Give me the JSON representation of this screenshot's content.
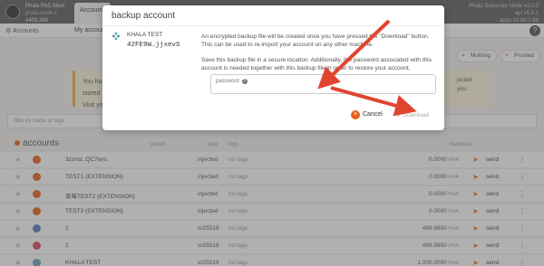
{
  "topbar": {
    "chain_name": "Phala PoC-Next",
    "chain_sub": "phala-node-1",
    "block": "#409,380",
    "tab": "Accounts",
    "node_name": "Phala Substrate Node v3.0.0",
    "api": "api v5.5.1",
    "apps": "apps v0.94.2-86"
  },
  "subbar": {
    "accounts": "Accounts",
    "my": "My account",
    "help": "?"
  },
  "actions": {
    "multisig": "Multisig",
    "proxied": "Proxied"
  },
  "banner": {
    "line1": "You ha",
    "line2": "stored",
    "line3": "Visit yo",
    "side1": "jected",
    "side2": "you."
  },
  "filter": {
    "placeholder": "filter by name or tags"
  },
  "table": {
    "title": "accounts",
    "headers": {
      "parent": "parent",
      "type": "type",
      "tags": "tags",
      "balances": "balances"
    },
    "rows": [
      {
        "name": "3zzncr..QC7wrs",
        "type": "injected",
        "tags": "no tags",
        "balance": "0.0000",
        "unit": "PHA",
        "send": "send"
      },
      {
        "name": "TEST1 (EXTENSION)",
        "type": "injected",
        "tags": "no tags",
        "balance": "0.0000",
        "unit": "PHA",
        "send": "send"
      },
      {
        "name": "草莓TEST2 (EXTENSION)",
        "type": "injected",
        "tags": "no tags",
        "balance": "0.0000",
        "unit": "PHA",
        "send": "send"
      },
      {
        "name": "TEST3 (EXTENSION)",
        "type": "injected",
        "tags": "no tags",
        "balance": "0.0000",
        "unit": "PHA",
        "send": "send"
      },
      {
        "name": "1",
        "type": "sr25519",
        "tags": "no tags",
        "balance": "499.9850",
        "unit": "PHA",
        "send": "send"
      },
      {
        "name": "2",
        "type": "sr25519",
        "tags": "no tags",
        "balance": "499.9850",
        "unit": "PHA",
        "send": "send"
      },
      {
        "name": "KHALA TEST",
        "type": "sr25519",
        "tags": "no tags",
        "balance": "1,000.0000",
        "unit": "PHA",
        "send": "send"
      }
    ]
  },
  "modal": {
    "title": "backup account",
    "account_name": "KHALA TEST",
    "account_address": "42FE9W…jjxevS",
    "text1": "An encrypted backup file will be created once you have pressed the \"Download\" button. This can be used to re-import your account on any other machine.",
    "text2": "Save this backup file in a secure location. Additionally, the password associated with this account is needed together with this backup file in order to restore your account.",
    "password_label": "password",
    "cancel": "Cancel",
    "download": "Download"
  },
  "colors": {
    "accent": "#e8611b",
    "arrow": "#e0452f"
  }
}
